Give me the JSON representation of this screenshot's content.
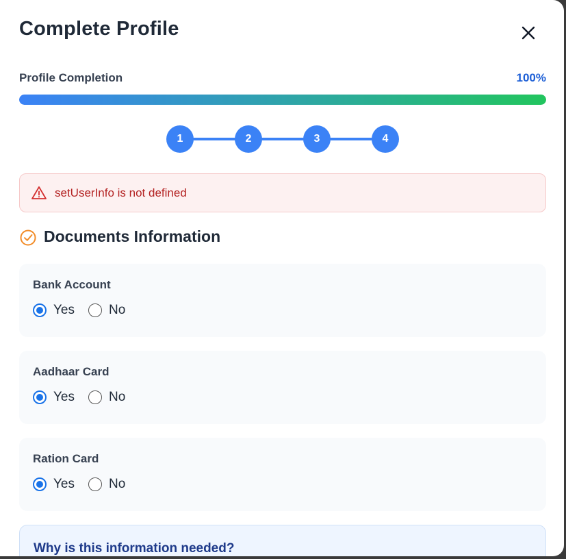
{
  "modal": {
    "title": "Complete Profile",
    "close_icon": "close-icon"
  },
  "progress": {
    "label": "Profile Completion",
    "percent_text": "100%",
    "value": 1.0,
    "gradient_start": "#3b82f6",
    "gradient_end": "#22c55e"
  },
  "steps": [
    "1",
    "2",
    "3",
    "4"
  ],
  "alert": {
    "icon": "warning-triangle-icon",
    "message": "setUserInfo is not defined",
    "color": "#b42323"
  },
  "section": {
    "icon": "check-circle-icon",
    "title": "Documents Information"
  },
  "documents": [
    {
      "label": "Bank Account",
      "options": [
        "Yes",
        "No"
      ],
      "selected": "Yes"
    },
    {
      "label": "Aadhaar Card",
      "options": [
        "Yes",
        "No"
      ],
      "selected": "Yes"
    },
    {
      "label": "Ration Card",
      "options": [
        "Yes",
        "No"
      ],
      "selected": "Yes"
    }
  ],
  "info": {
    "title": "Why is this information needed?"
  },
  "colors": {
    "accent": "#3b82f6",
    "radio_selected": "#1a73e8",
    "section_icon": "#f28c28"
  }
}
